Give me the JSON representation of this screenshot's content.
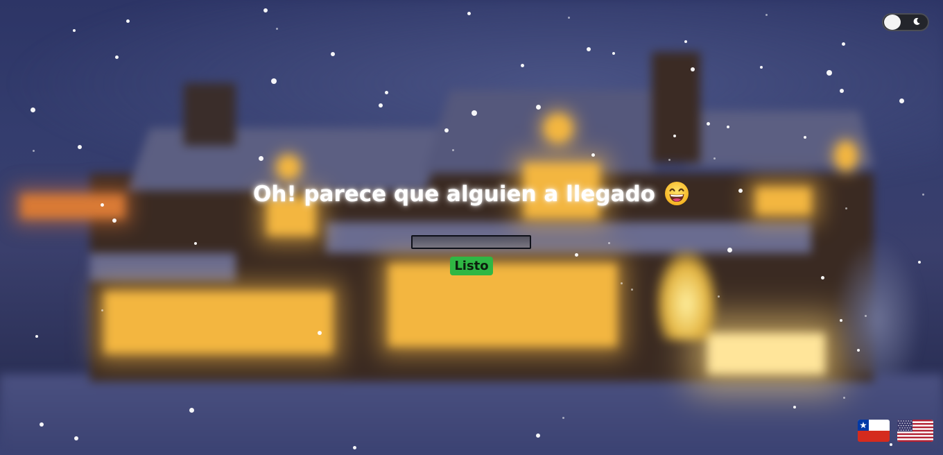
{
  "header": {
    "theme_toggle": {
      "state": "off",
      "icon": "moon-icon"
    }
  },
  "main": {
    "title": "Oh! parece que alguien a llegado",
    "title_emoji": "grinning-face-with-smiling-eyes",
    "name_input": {
      "value": "",
      "placeholder": ""
    },
    "submit_label": "Listo"
  },
  "languages": [
    {
      "name": "flag-chile",
      "icon": "chile-flag-icon"
    },
    {
      "name": "flag-usa",
      "icon": "usa-flag-icon"
    }
  ],
  "colors": {
    "button_bg": "#2fb744",
    "title_text": "#ffffff",
    "background": "#343d6e"
  }
}
